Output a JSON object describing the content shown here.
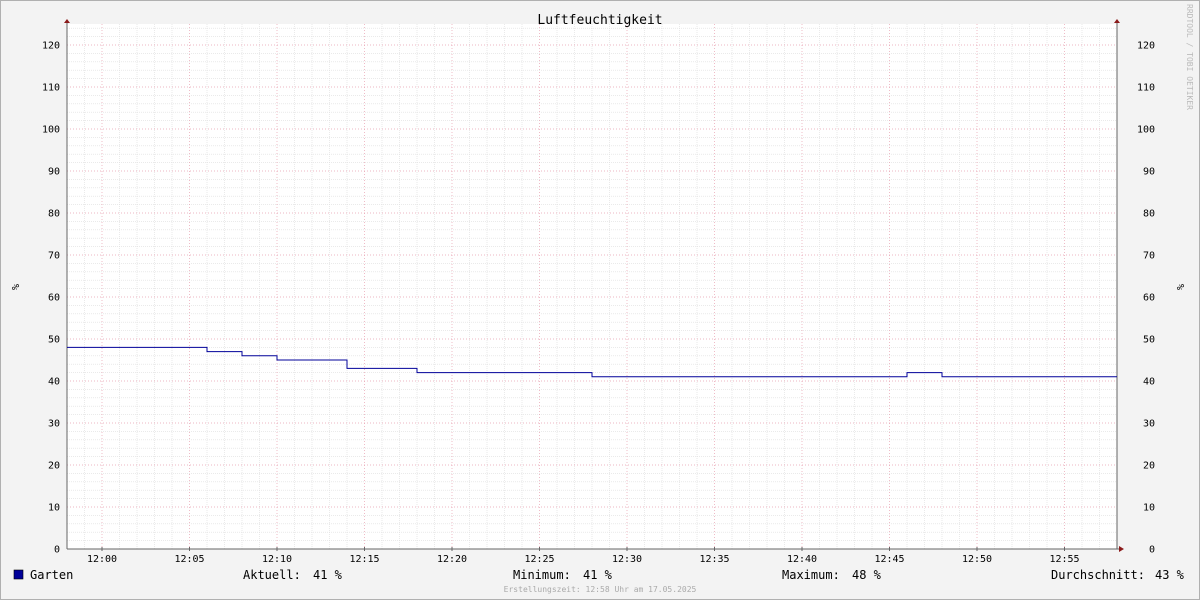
{
  "chart_data": {
    "type": "line",
    "title": "Luftfeuchtigkeit",
    "ylabel": "%",
    "ylabel_right": "%",
    "ylim": [
      0,
      125
    ],
    "yticks": [
      0,
      10,
      20,
      30,
      40,
      50,
      60,
      70,
      80,
      90,
      100,
      110,
      120
    ],
    "xlim": [
      "11:58",
      "12:58"
    ],
    "xticks": [
      "12:00",
      "12:05",
      "12:10",
      "12:15",
      "12:20",
      "12:25",
      "12:30",
      "12:35",
      "12:40",
      "12:45",
      "12:50",
      "12:55"
    ],
    "grid": true,
    "series": [
      {
        "name": "Garten",
        "color": "#000099",
        "step": true,
        "points": [
          [
            "11:58",
            48
          ],
          [
            "12:06",
            47
          ],
          [
            "12:08",
            46
          ],
          [
            "12:10",
            45
          ],
          [
            "12:14",
            43
          ],
          [
            "12:18",
            42
          ],
          [
            "12:28",
            41
          ],
          [
            "12:46",
            42
          ],
          [
            "12:48",
            41
          ],
          [
            "12:58",
            41
          ]
        ]
      }
    ],
    "legend": {
      "entries": [
        {
          "label": "Garten",
          "color": "#000099"
        }
      ],
      "stats": [
        {
          "label": "Aktuell:",
          "value": "41 %"
        },
        {
          "label": "Minimum:",
          "value": "41 %"
        },
        {
          "label": "Maximum:",
          "value": "48 %"
        },
        {
          "label": "Durchschnitt:",
          "value": "43 %"
        }
      ]
    },
    "watermark": "RRDTOOL / TOBI OETIKER",
    "footnote": "Erstellungszeit: 12:58 Uhr am 17.05.2025"
  },
  "colors": {
    "background": "#f3f3f3",
    "plot_background": "#ffffff",
    "major_grid": "#e8a0b0",
    "minor_grid": "#dddddd",
    "axis": "#666666",
    "arrow": "#8b1a1a"
  }
}
